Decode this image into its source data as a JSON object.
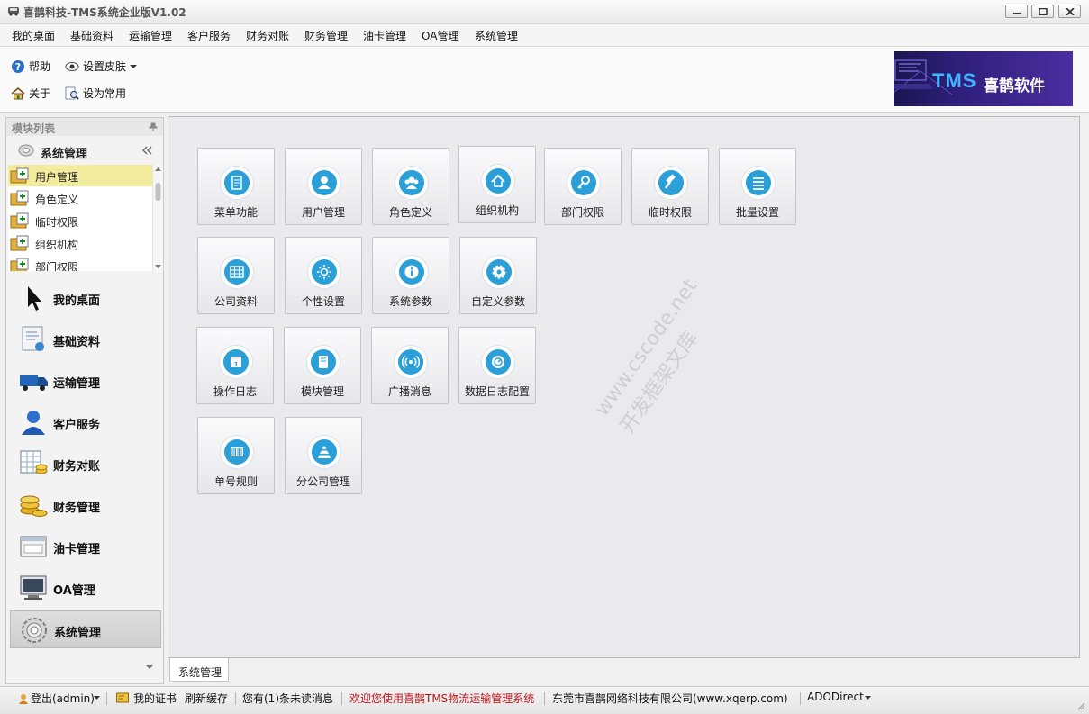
{
  "window": {
    "title": "喜鹊科技-TMS系统企业版V1.02"
  },
  "menu": [
    "我的桌面",
    "基础资料",
    "运输管理",
    "客户服务",
    "财务对账",
    "财务管理",
    "油卡管理",
    "OA管理",
    "系统管理"
  ],
  "toolbar": {
    "help": "帮助",
    "skin": "设置皮肤",
    "about": "关于",
    "set_common": "设为常用"
  },
  "banner": {
    "tms": "TMS",
    "brand": "喜鹊软件"
  },
  "left_panel": {
    "title": "模块列表",
    "group_title": "系统管理",
    "sub_items": [
      "用户管理",
      "角色定义",
      "临时权限",
      "组织机构",
      "部门权限"
    ],
    "nav_items": [
      "我的桌面",
      "基础资料",
      "运输管理",
      "客户服务",
      "财务对账",
      "财务管理",
      "油卡管理",
      "OA管理",
      "系统管理"
    ]
  },
  "tiles": [
    {
      "label": "菜单功能",
      "icon": "document-icon"
    },
    {
      "label": "用户管理",
      "icon": "user-icon"
    },
    {
      "label": "角色定义",
      "icon": "role-icon"
    },
    {
      "label": "组织机构",
      "icon": "home-icon"
    },
    {
      "label": "部门权限",
      "icon": "key-icon"
    },
    {
      "label": "临时权限",
      "icon": "hammer-icon"
    },
    {
      "label": "批量设置",
      "icon": "list-icon"
    },
    {
      "label": "公司资料",
      "icon": "table-icon"
    },
    {
      "label": "个性设置",
      "icon": "sun-icon"
    },
    {
      "label": "系统参数",
      "icon": "info-icon"
    },
    {
      "label": "自定义参数",
      "icon": "gear-icon"
    },
    {
      "label": "操作日志",
      "icon": "calendar-icon"
    },
    {
      "label": "模块管理",
      "icon": "module-icon"
    },
    {
      "label": "广播消息",
      "icon": "broadcast-icon"
    },
    {
      "label": "数据日志配置",
      "icon": "dial-icon"
    },
    {
      "label": "单号规则",
      "icon": "barcode-icon"
    },
    {
      "label": "分公司管理",
      "icon": "pyramid-icon"
    }
  ],
  "watermark": {
    "line1": "www.cscode.net",
    "line2": "开发框架文库"
  },
  "tab": {
    "label": "系统管理"
  },
  "status": {
    "logout": "登出(admin)",
    "certificate": "我的证书",
    "refresh": "刷新缓存",
    "unread": "您有(1)条未读消息",
    "welcome": "欢迎您使用喜鹊TMS物流运输管理系统",
    "company": "东莞市喜鹊网络科技有限公司(www.xqerp.com)",
    "db": "ADODirect"
  },
  "colors": {
    "accent": "#2a9fd8",
    "welcome_text": "#c0141b",
    "active_sub": "#f2ec9e"
  }
}
